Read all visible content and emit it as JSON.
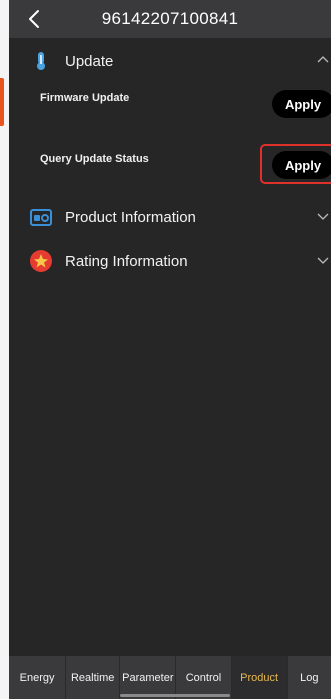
{
  "header": {
    "title": "96142207100841"
  },
  "sections": [
    {
      "label": "Update",
      "icon": "thermometer-icon",
      "expanded": true
    },
    {
      "label": "Product Information",
      "icon": "device-icon",
      "expanded": false
    },
    {
      "label": "Rating Information",
      "icon": "star-icon",
      "expanded": false
    }
  ],
  "update": {
    "rows": [
      {
        "label": "Firmware Update",
        "button": "Apply"
      },
      {
        "label": "Query Update Status",
        "button": "Apply"
      }
    ]
  },
  "tabs": [
    "Energy",
    "Realtime",
    "Parameter",
    "Control",
    "Product",
    "Log"
  ],
  "active_tab": "Product",
  "colors": {
    "accent": "#e7b84a",
    "highlight": "#e0302b",
    "background": "#262626",
    "bar": "#3a3a3c"
  }
}
